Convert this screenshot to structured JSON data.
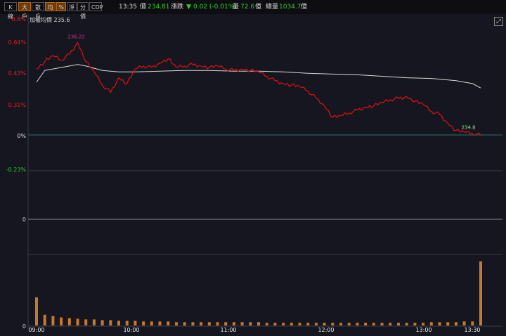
{
  "toolbar": {
    "buttons": [
      {
        "label": "K線",
        "active": false
      },
      {
        "label": "大戶",
        "active": true
      },
      {
        "label": "散戶",
        "active": false
      },
      {
        "label": "均",
        "active": true
      },
      {
        "label": "%",
        "active": true
      },
      {
        "label": "淨",
        "active": false
      },
      {
        "label": "分價",
        "active": false
      },
      {
        "label": "CDP",
        "active": false
      }
    ],
    "time": "13:35",
    "price_label": "價",
    "price": "234.81",
    "change_label": "漲跌",
    "change_arrow": "▼",
    "change": "0.02 (-0.01%)",
    "volume_label": "量",
    "volume": "72.6",
    "volume_unit": "億",
    "total_volume_label": "總量",
    "total_volume": "1034.7",
    "total_volume_unit": "億"
  },
  "colors": {
    "price_line": "#e01010",
    "avg_line": "#d8d8d8",
    "volume_bar": "#c8782a",
    "up_text": "#e02020",
    "down_text": "#35c935",
    "max_label": "#d0308f",
    "last_label": "#9adf9a"
  },
  "chart_data": {
    "type": "line",
    "title": "",
    "legend": "加權均價 235.6",
    "avg_price_label": "加權均價",
    "avg_price": 235.6,
    "y_ticks": [
      "0.8%",
      "0.64%",
      "0.43%",
      "0.31%",
      "0%",
      "-0.23%"
    ],
    "ylim_pct": [
      -0.23,
      0.8
    ],
    "volume_tick": "0",
    "mid_tick": "0",
    "x_ticks": [
      "09:00",
      "10:00",
      "11:00",
      "12:00",
      "13:00",
      "13:30"
    ],
    "max_label": "236.22",
    "last_label": "234.8",
    "series": [
      {
        "name": "",
        "key": "price",
        "x": [
          "09:00",
          "09:05",
          "09:10",
          "09:15",
          "09:20",
          "09:25",
          "09:30",
          "09:35",
          "09:40",
          "09:45",
          "09:50",
          "09:55",
          "10:00",
          "10:05",
          "10:10",
          "10:15",
          "10:20",
          "10:25",
          "10:30",
          "10:35",
          "10:40",
          "10:45",
          "10:50",
          "10:55",
          "11:00",
          "11:05",
          "11:10",
          "11:15",
          "11:20",
          "11:25",
          "11:30",
          "11:35",
          "11:40",
          "11:45",
          "11:50",
          "11:55",
          "12:00",
          "12:05",
          "12:10",
          "12:15",
          "12:20",
          "12:25",
          "12:30",
          "12:35",
          "12:40",
          "12:45",
          "12:50",
          "12:55",
          "13:00",
          "13:05",
          "13:10",
          "13:15",
          "13:20",
          "13:25",
          "13:30"
        ],
        "values_pct": [
          0.45,
          0.5,
          0.54,
          0.51,
          0.55,
          0.63,
          0.5,
          0.43,
          0.34,
          0.29,
          0.39,
          0.35,
          0.45,
          0.47,
          0.46,
          0.49,
          0.52,
          0.46,
          0.47,
          0.48,
          0.47,
          0.46,
          0.47,
          0.45,
          0.44,
          0.45,
          0.44,
          0.43,
          0.4,
          0.37,
          0.35,
          0.34,
          0.33,
          0.3,
          0.25,
          0.2,
          0.12,
          0.13,
          0.15,
          0.17,
          0.19,
          0.2,
          0.22,
          0.24,
          0.25,
          0.26,
          0.23,
          0.21,
          0.16,
          0.14,
          0.08,
          0.03,
          0.02,
          0.01,
          0.0
        ]
      },
      {
        "name": "",
        "key": "avg",
        "x": [
          "09:00",
          "09:05",
          "09:10",
          "09:15",
          "09:20",
          "09:25",
          "09:30",
          "09:40",
          "09:50",
          "10:00",
          "10:15",
          "10:30",
          "10:45",
          "11:00",
          "11:15",
          "11:30",
          "11:45",
          "12:00",
          "12:15",
          "12:30",
          "12:45",
          "13:00",
          "13:15",
          "13:25",
          "13:30"
        ],
        "values_pct": [
          0.36,
          0.44,
          0.45,
          0.46,
          0.47,
          0.48,
          0.47,
          0.44,
          0.43,
          0.43,
          0.435,
          0.44,
          0.44,
          0.435,
          0.435,
          0.43,
          0.42,
          0.415,
          0.41,
          0.4,
          0.39,
          0.385,
          0.37,
          0.35,
          0.32
        ]
      }
    ],
    "volume": {
      "x": [
        "09:00",
        "09:05",
        "09:10",
        "09:15",
        "09:20",
        "09:25",
        "09:30",
        "09:35",
        "09:40",
        "09:45",
        "09:50",
        "09:55",
        "10:00",
        "10:05",
        "10:10",
        "10:15",
        "10:20",
        "10:25",
        "10:30",
        "10:35",
        "10:40",
        "10:45",
        "10:50",
        "10:55",
        "11:00",
        "11:05",
        "11:10",
        "11:15",
        "11:20",
        "11:25",
        "11:30",
        "11:35",
        "11:40",
        "11:45",
        "11:50",
        "11:55",
        "12:00",
        "12:05",
        "12:10",
        "12:15",
        "12:20",
        "12:25",
        "12:30",
        "12:35",
        "12:40",
        "12:45",
        "12:50",
        "12:55",
        "13:00",
        "13:05",
        "13:10",
        "13:15",
        "13:20",
        "13:25",
        "13:30"
      ],
      "values": [
        42,
        16,
        14,
        12,
        11,
        10,
        9,
        9,
        8,
        8,
        7,
        7,
        7,
        6,
        6,
        6,
        6,
        5,
        5,
        5,
        5,
        5,
        5,
        5,
        5,
        5,
        5,
        5,
        4,
        4,
        4,
        4,
        4,
        4,
        4,
        4,
        4,
        4,
        4,
        4,
        4,
        4,
        4,
        4,
        4,
        4,
        4,
        4,
        5,
        5,
        5,
        5,
        6,
        6,
        96
      ],
      "ylim": [
        0,
        100
      ]
    }
  }
}
